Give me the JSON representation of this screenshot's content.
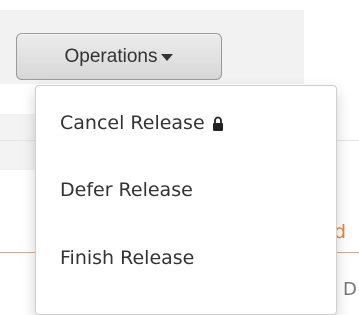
{
  "toolbar": {
    "operations_label": "Operations"
  },
  "menu": {
    "items": [
      {
        "label": "Cancel Release",
        "locked": true
      },
      {
        "label": "Defer Release",
        "locked": false
      },
      {
        "label": "Finish Release",
        "locked": false
      }
    ]
  },
  "background": {
    "right_text_1": "d",
    "right_text_2": "D"
  },
  "colors": {
    "menu_text": "#333333",
    "button_border": "#9a9a9a",
    "orange_accent": "#e8853b"
  },
  "icons": {
    "operations_caret": "caret-down-icon",
    "cancel_release_lock": "lock-icon"
  }
}
